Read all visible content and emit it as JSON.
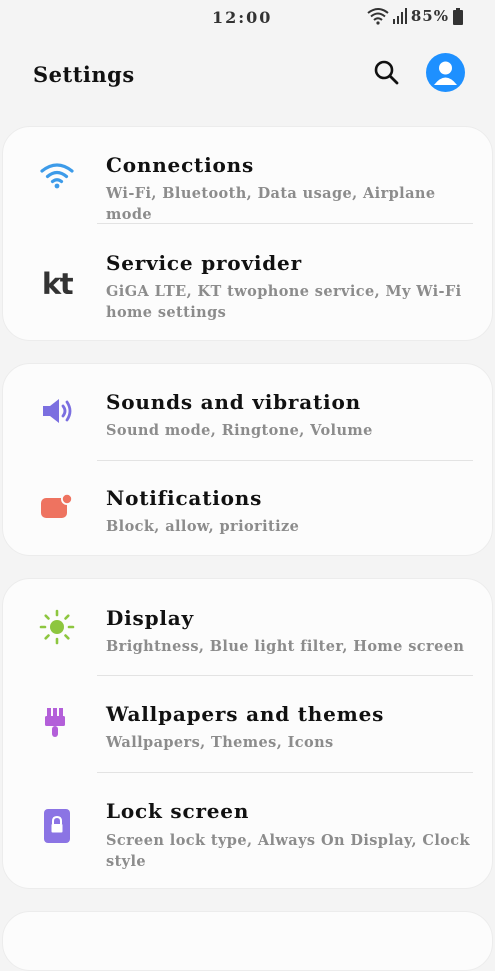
{
  "status_bar": {
    "time": "12:00",
    "battery": "85%"
  },
  "header": {
    "title": "Settings"
  },
  "groups": [
    {
      "items": [
        {
          "title": "Connections",
          "subtitle": "Wi-Fi, Bluetooth, Data usage, Airplane mode",
          "icon": "wifi-icon",
          "color": "#3d9be9"
        },
        {
          "title": "Service provider",
          "subtitle": "GiGA LTE, KT twophone service, My Wi-Fi home settings",
          "icon": "kt-logo-icon",
          "color": "#333333",
          "logo_text": "kt"
        }
      ]
    },
    {
      "items": [
        {
          "title": "Sounds and vibration",
          "subtitle": "Sound mode, Ringtone, Volume",
          "icon": "speaker-icon",
          "color": "#7b6fe0"
        },
        {
          "title": "Notifications",
          "subtitle": "Block, allow, prioritize",
          "icon": "notification-badge-icon",
          "color": "#ee7360"
        }
      ]
    },
    {
      "items": [
        {
          "title": "Display",
          "subtitle": "Brightness, Blue light filter, Home screen",
          "icon": "sun-icon",
          "color": "#8dc63f"
        },
        {
          "title": "Wallpapers and themes",
          "subtitle": "Wallpapers, Themes, Icons",
          "icon": "paint-brush-icon",
          "color": "#b35fd9"
        },
        {
          "title": "Lock screen",
          "subtitle": "Screen lock type, Always On Display, Clock style",
          "icon": "lock-icon",
          "color": "#8b74e4"
        }
      ]
    }
  ]
}
